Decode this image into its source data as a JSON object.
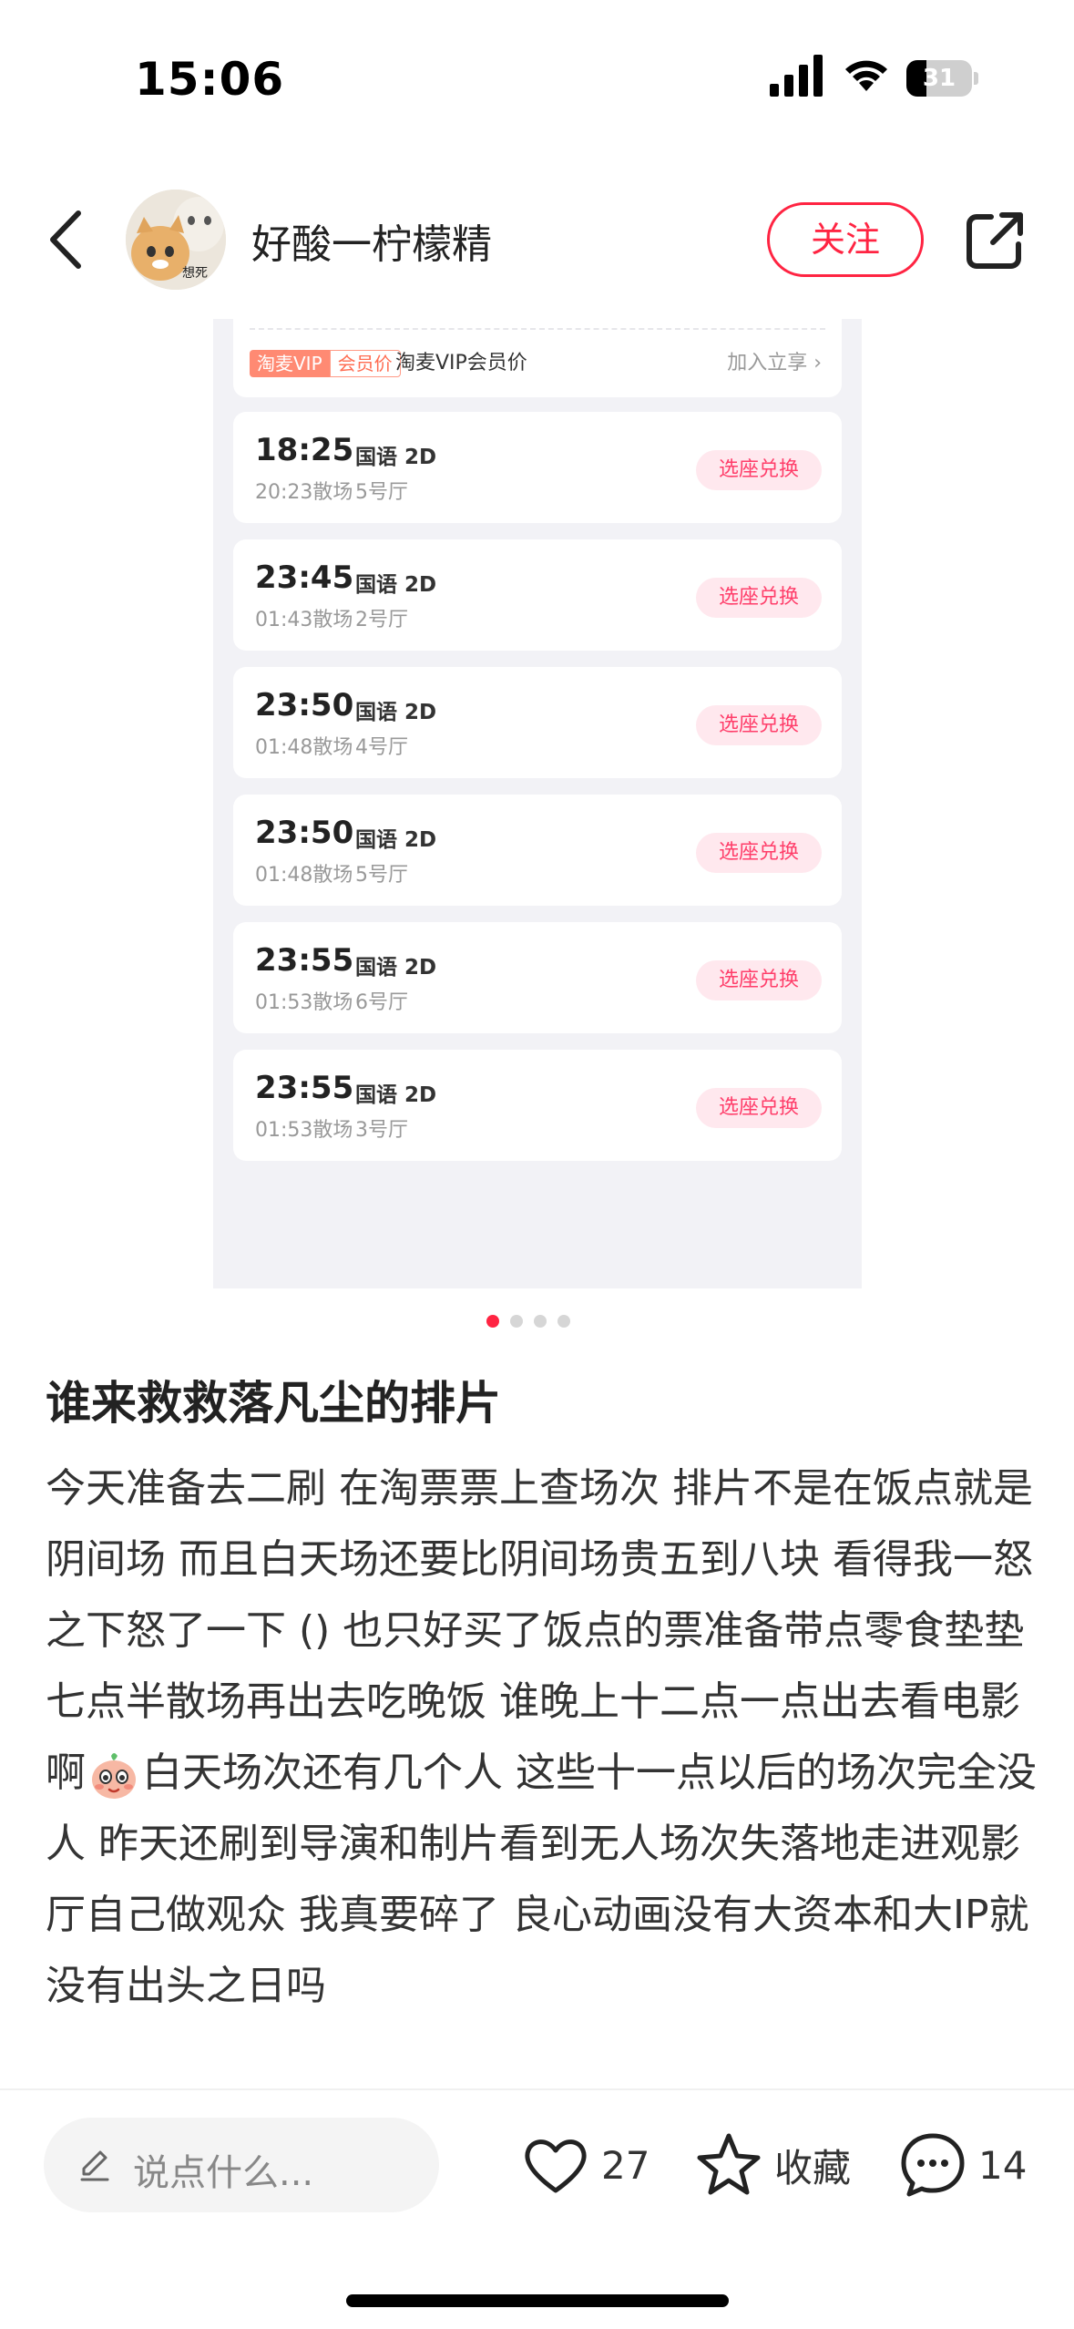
{
  "status": {
    "time": "15:06",
    "battery": "31",
    "battery_level": 0.31
  },
  "header": {
    "username": "好酸一柠檬精",
    "follow_label": "关注",
    "avatar_caption": "想死"
  },
  "screenshot": {
    "vip": {
      "badge_left": "淘麦VIP",
      "badge_right": "会员价",
      "text": "淘麦VIP会员价",
      "join": "加入立享 ›"
    },
    "sessions": [
      {
        "time": "18:25",
        "lang": "国语 2D",
        "end": "20:23散场",
        "hall": "5号厅",
        "btn": "选座兑换"
      },
      {
        "time": "23:45",
        "lang": "国语 2D",
        "end": "01:43散场",
        "hall": "2号厅",
        "btn": "选座兑换"
      },
      {
        "time": "23:50",
        "lang": "国语 2D",
        "end": "01:48散场",
        "hall": "4号厅",
        "btn": "选座兑换"
      },
      {
        "time": "23:50",
        "lang": "国语 2D",
        "end": "01:48散场",
        "hall": "5号厅",
        "btn": "选座兑换"
      },
      {
        "time": "23:55",
        "lang": "国语 2D",
        "end": "01:53散场",
        "hall": "6号厅",
        "btn": "选座兑换"
      },
      {
        "time": "23:55",
        "lang": "国语 2D",
        "end": "01:53散场",
        "hall": "3号厅",
        "btn": "选座兑换"
      }
    ]
  },
  "pager": {
    "count": 4,
    "active": 1
  },
  "post": {
    "title": "谁来救救落凡尘的排片",
    "body_a": "今天准备去二刷 在淘票票上查场次 排片不是在饭点就是阴间场  而且白天场还要比阴间场贵五到八块 看得我一怒之下怒了一下 () 也只好买了饭点的票准备带点零食垫垫 七点半散场再出去吃晚饭  谁晚上十二点一点出去看电影啊",
    "body_b": "白天场次还有几个人 这些十一点以后的场次完全没人  昨天还刷到导演和制片看到无人场次失落地走进观影厅自己做观众 我真要碎了 良心动画没有大资本和大IP就没有出头之日吗"
  },
  "bottom": {
    "comment_placeholder": "说点什么...",
    "likes": "27",
    "collect_label": "收藏",
    "comments": "14"
  }
}
